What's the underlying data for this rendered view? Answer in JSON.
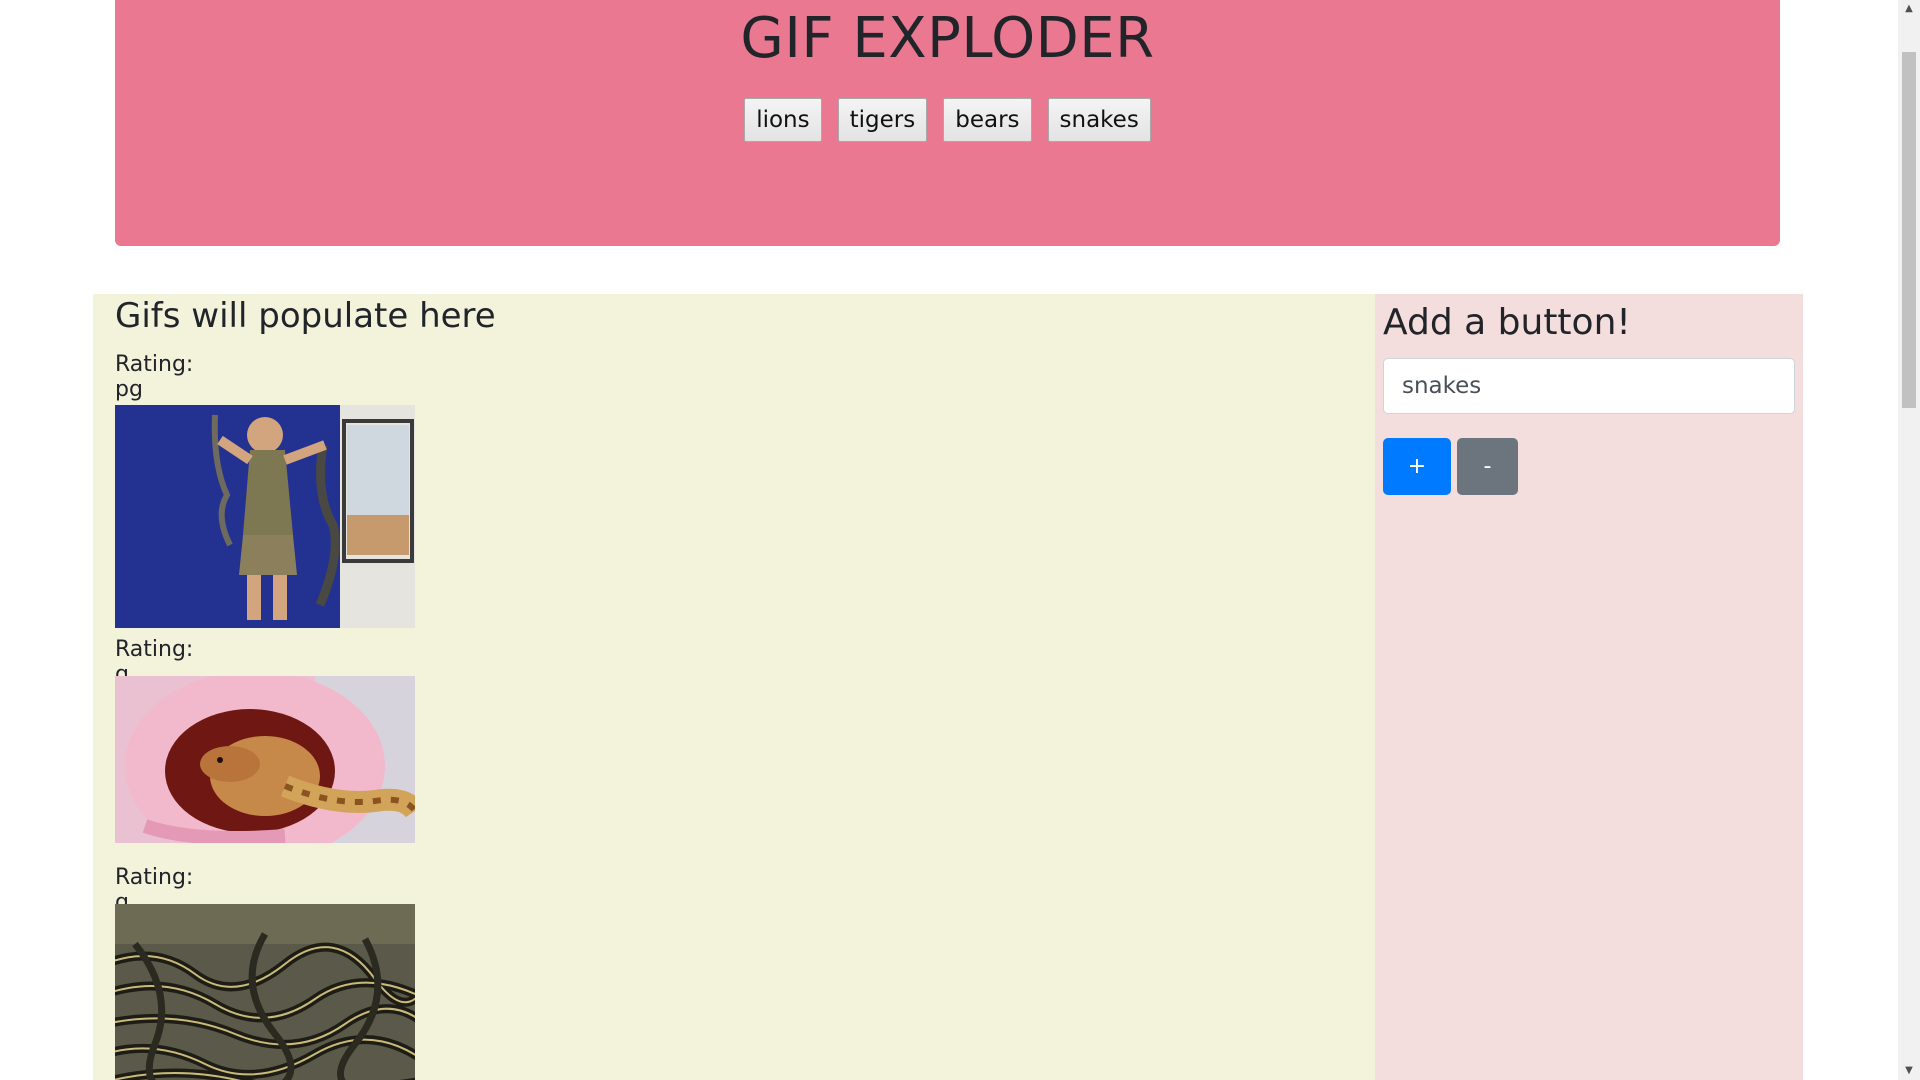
{
  "header": {
    "title": "GIF EXPLODER",
    "topic_buttons": [
      "lions",
      "tigers",
      "bears",
      "snakes"
    ]
  },
  "gifs": {
    "heading": "Gifs will populate here",
    "items": [
      {
        "rating": "Rating: pg",
        "subject": "man handling snakes"
      },
      {
        "rating": "Rating: g",
        "subject": "snake in pink knit"
      },
      {
        "rating": "Rating: g",
        "subject": "mass of snakes"
      }
    ]
  },
  "add_panel": {
    "heading": "Add a button!",
    "input_value": "snakes",
    "add_label": "+",
    "remove_label": "-"
  },
  "colors": {
    "jumbotron": "#ea7890",
    "gif_panel": "#f3f3dc",
    "add_panel": "#f4dddd",
    "add_button": "#007bff",
    "remove_button": "#6c757d"
  },
  "scrollbar": {
    "up_icon": "triangle-up-icon",
    "down_icon": "triangle-down-icon"
  }
}
